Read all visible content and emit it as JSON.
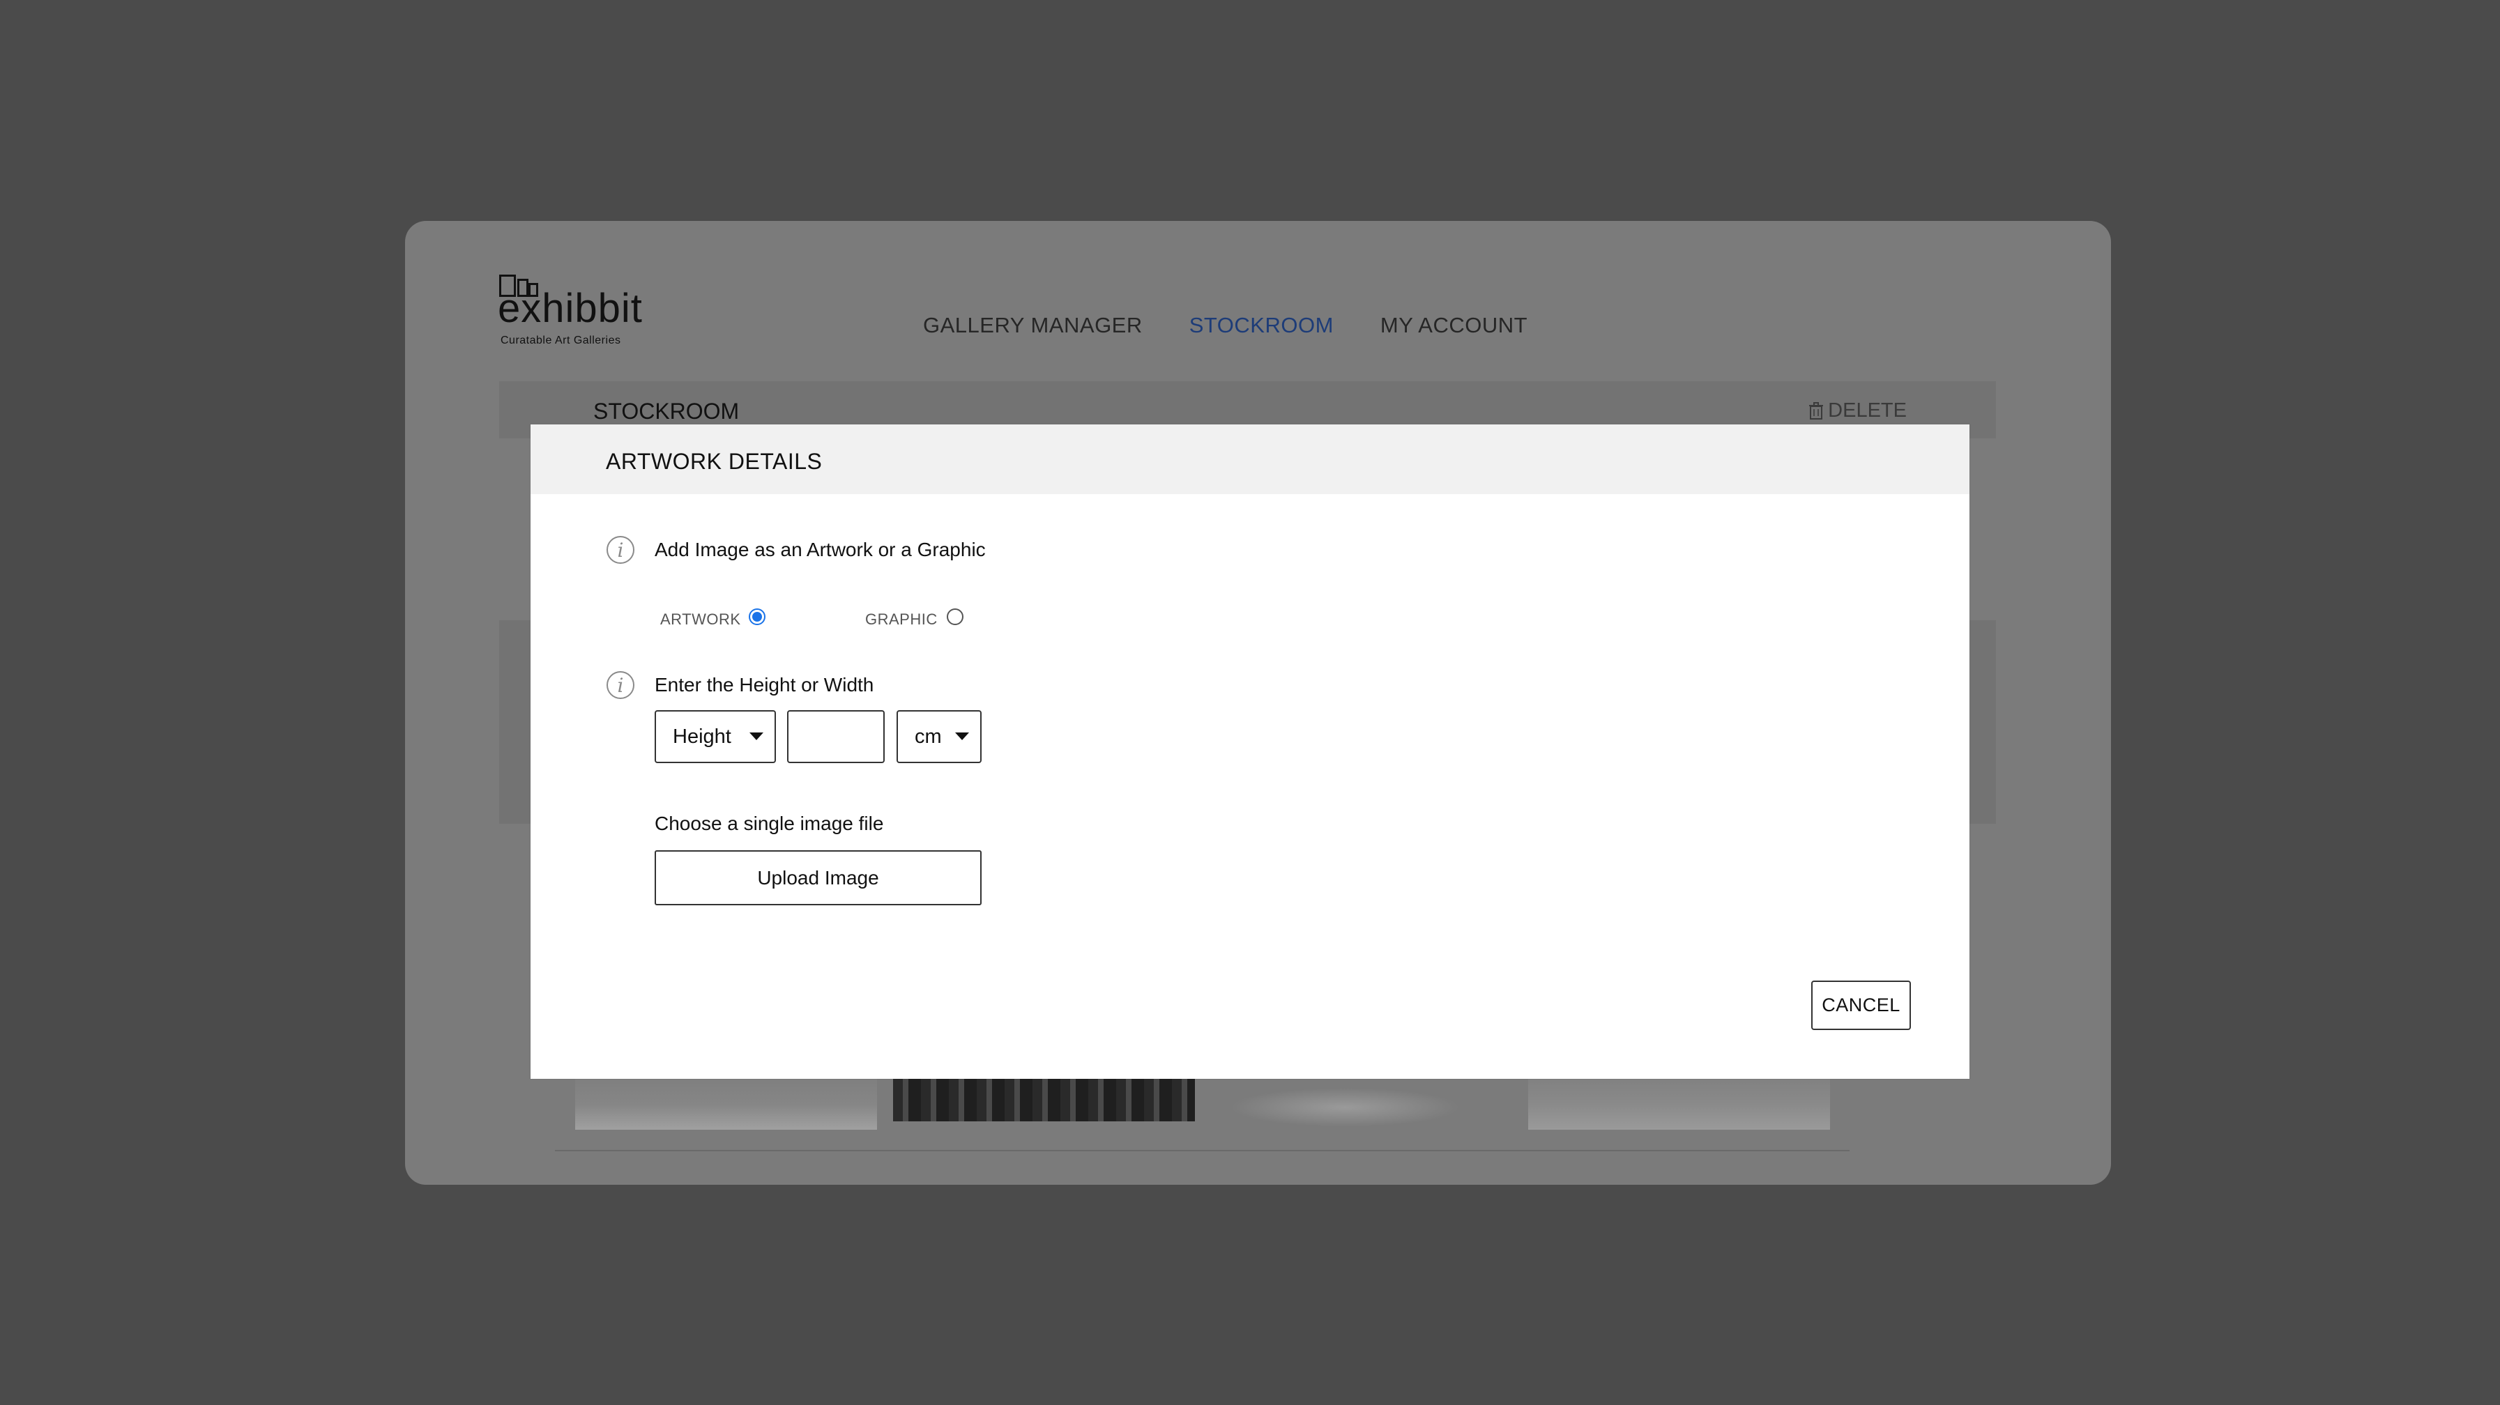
{
  "app": {
    "logo_word": "exhibbit",
    "logo_tagline": "Curatable Art Galleries"
  },
  "nav": {
    "items": [
      {
        "label": "GALLERY MANAGER",
        "active": false
      },
      {
        "label": "STOCKROOM",
        "active": true
      },
      {
        "label": "MY ACCOUNT",
        "active": false
      }
    ]
  },
  "subbar": {
    "title": "STOCKROOM",
    "delete_label": "DELETE",
    "delete_icon": "trash-icon"
  },
  "modal": {
    "title": "ARTWORK DETAILS",
    "type_section": {
      "label": "Add Image as an Artwork or a Graphic",
      "options": [
        {
          "label": "ARTWORK",
          "checked": true
        },
        {
          "label": "GRAPHIC",
          "checked": false
        }
      ]
    },
    "size_section": {
      "label": "Enter the Height or Width",
      "dimension_select": "Height",
      "value": "",
      "unit_select": "cm"
    },
    "file_section": {
      "label": "Choose a single image file",
      "upload_label": "Upload Image"
    },
    "cancel_label": "CANCEL"
  },
  "colors": {
    "backdrop": "#4b4b4b",
    "nav_active": "#1d3c78",
    "radio_checked": "#1a73e8",
    "modal_header": "#f1f1f1"
  }
}
